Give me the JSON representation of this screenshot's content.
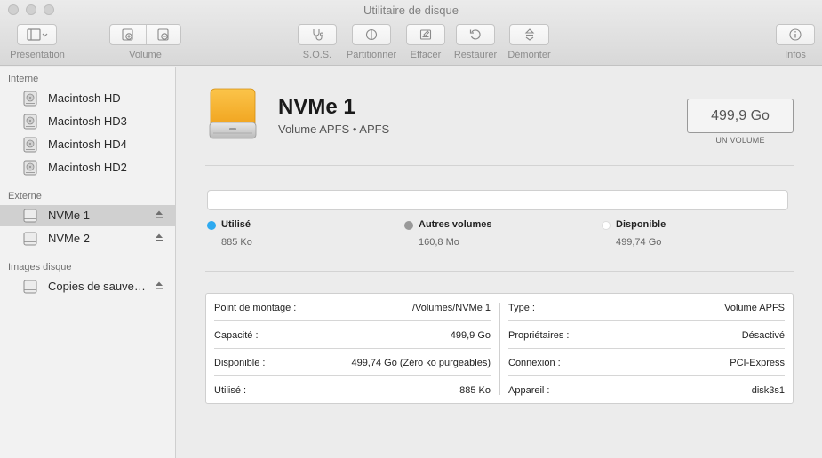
{
  "window": {
    "title": "Utilitaire de disque"
  },
  "toolbar": {
    "presentation_label": "Présentation",
    "volume_label": "Volume",
    "sos_label": "S.O.S.",
    "partition_label": "Partitionner",
    "erase_label": "Effacer",
    "restore_label": "Restaurer",
    "unmount_label": "Démonter",
    "info_label": "Infos"
  },
  "sidebar": {
    "sections": [
      {
        "title": "Interne",
        "items": [
          {
            "label": "Macintosh HD"
          },
          {
            "label": "Macintosh HD3"
          },
          {
            "label": "Macintosh HD4"
          },
          {
            "label": "Macintosh HD2"
          }
        ]
      },
      {
        "title": "Externe",
        "items": [
          {
            "label": "NVMe 1",
            "selected": true
          },
          {
            "label": "NVMe 2"
          }
        ]
      },
      {
        "title": "Images disque",
        "items": [
          {
            "label": "Copies de sauve…"
          }
        ]
      }
    ]
  },
  "volume": {
    "name": "NVMe 1",
    "subtitle": "Volume APFS • APFS",
    "size": "499,9 Go",
    "size_caption": "UN VOLUME"
  },
  "usage": {
    "used": {
      "name": "Utilisé",
      "value": "885 Ko",
      "color": "#2eaaf0"
    },
    "others": {
      "name": "Autres volumes",
      "value": "160,8 Mo",
      "color": "#999999"
    },
    "free": {
      "name": "Disponible",
      "value": "499,74 Go",
      "color": "#ffffff"
    }
  },
  "info": {
    "left": [
      {
        "key": "Point de montage :",
        "value": "/Volumes/NVMe 1"
      },
      {
        "key": "Capacité :",
        "value": "499,9 Go"
      },
      {
        "key": "Disponible :",
        "value": "499,74 Go (Zéro ko purgeables)"
      },
      {
        "key": "Utilisé :",
        "value": "885 Ko"
      }
    ],
    "right": [
      {
        "key": "Type :",
        "value": "Volume APFS"
      },
      {
        "key": "Propriétaires :",
        "value": "Désactivé"
      },
      {
        "key": "Connexion :",
        "value": "PCI-Express"
      },
      {
        "key": "Appareil :",
        "value": "disk3s1"
      }
    ]
  }
}
